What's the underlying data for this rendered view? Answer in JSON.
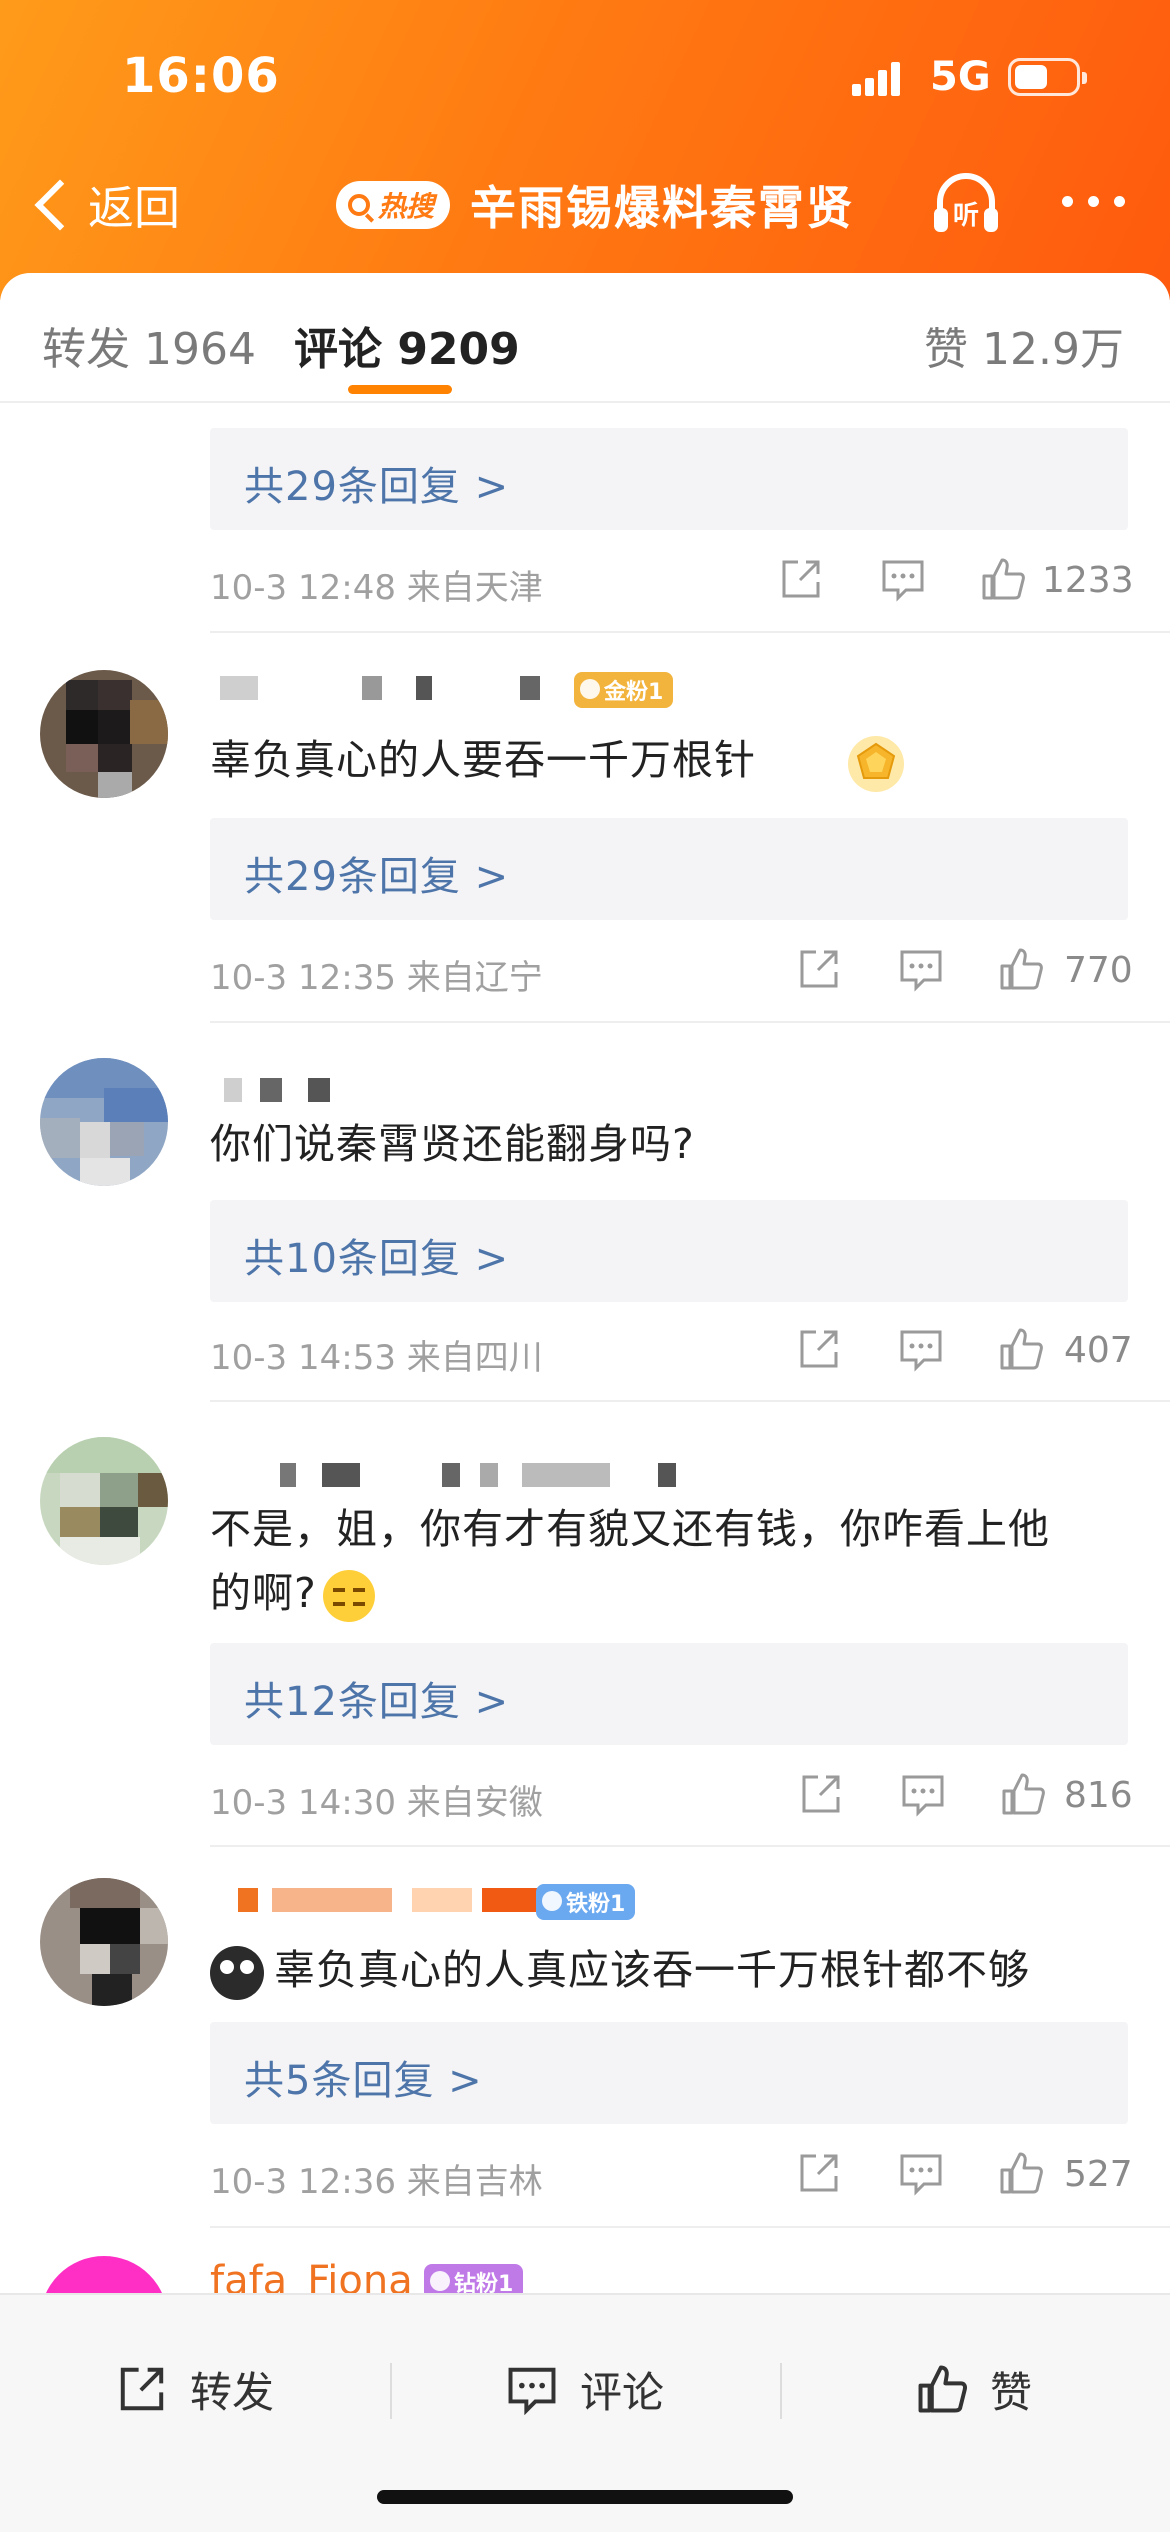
{
  "status_bar": {
    "time": "16:06",
    "network": "5G"
  },
  "nav": {
    "back_label": "返回",
    "hot_badge": "热搜",
    "title": "辛雨锡爆料秦霄贤",
    "listen_label": "听"
  },
  "tabs": {
    "repost": "转发 1964",
    "comment": "评论 9209",
    "like": "赞 12.9万"
  },
  "comments": [
    {
      "reply_label": "共29条回复 >",
      "meta": "10-3 12:48  来自天津",
      "likes": "1233"
    },
    {
      "fan_badge": "金粉1",
      "text": "辜负真心的人要吞一千万根针",
      "reply_label": "共29条回复 >",
      "meta": "10-3 12:35  来自辽宁",
      "likes": "770"
    },
    {
      "text": "你们说秦霄贤还能翻身吗?",
      "reply_label": "共10条回复 >",
      "meta": "10-3 14:53  来自四川",
      "likes": "407"
    },
    {
      "text_line1": "不是，姐，你有才有貌又还有钱，你咋看上他",
      "text_line2": "的啊?",
      "reply_label": "共12条回复 >",
      "meta": "10-3 14:30  来自安徽",
      "likes": "816"
    },
    {
      "fan_badge": "铁粉1",
      "text": "辜负真心的人真应该吞一千万根针都不够",
      "reply_label": "共5条回复 >",
      "meta": "10-3 12:36  来自吉林",
      "likes": "527"
    },
    {
      "username": "fafa_Fiona",
      "fan_badge": "钻粉1"
    }
  ],
  "bottom_bar": {
    "repost": "转发",
    "comment": "评论",
    "like": "赞"
  },
  "colors": {
    "header_orange": "#ff7a12",
    "reply_link": "#4e75a9",
    "tab_underline": "#ff8200"
  }
}
